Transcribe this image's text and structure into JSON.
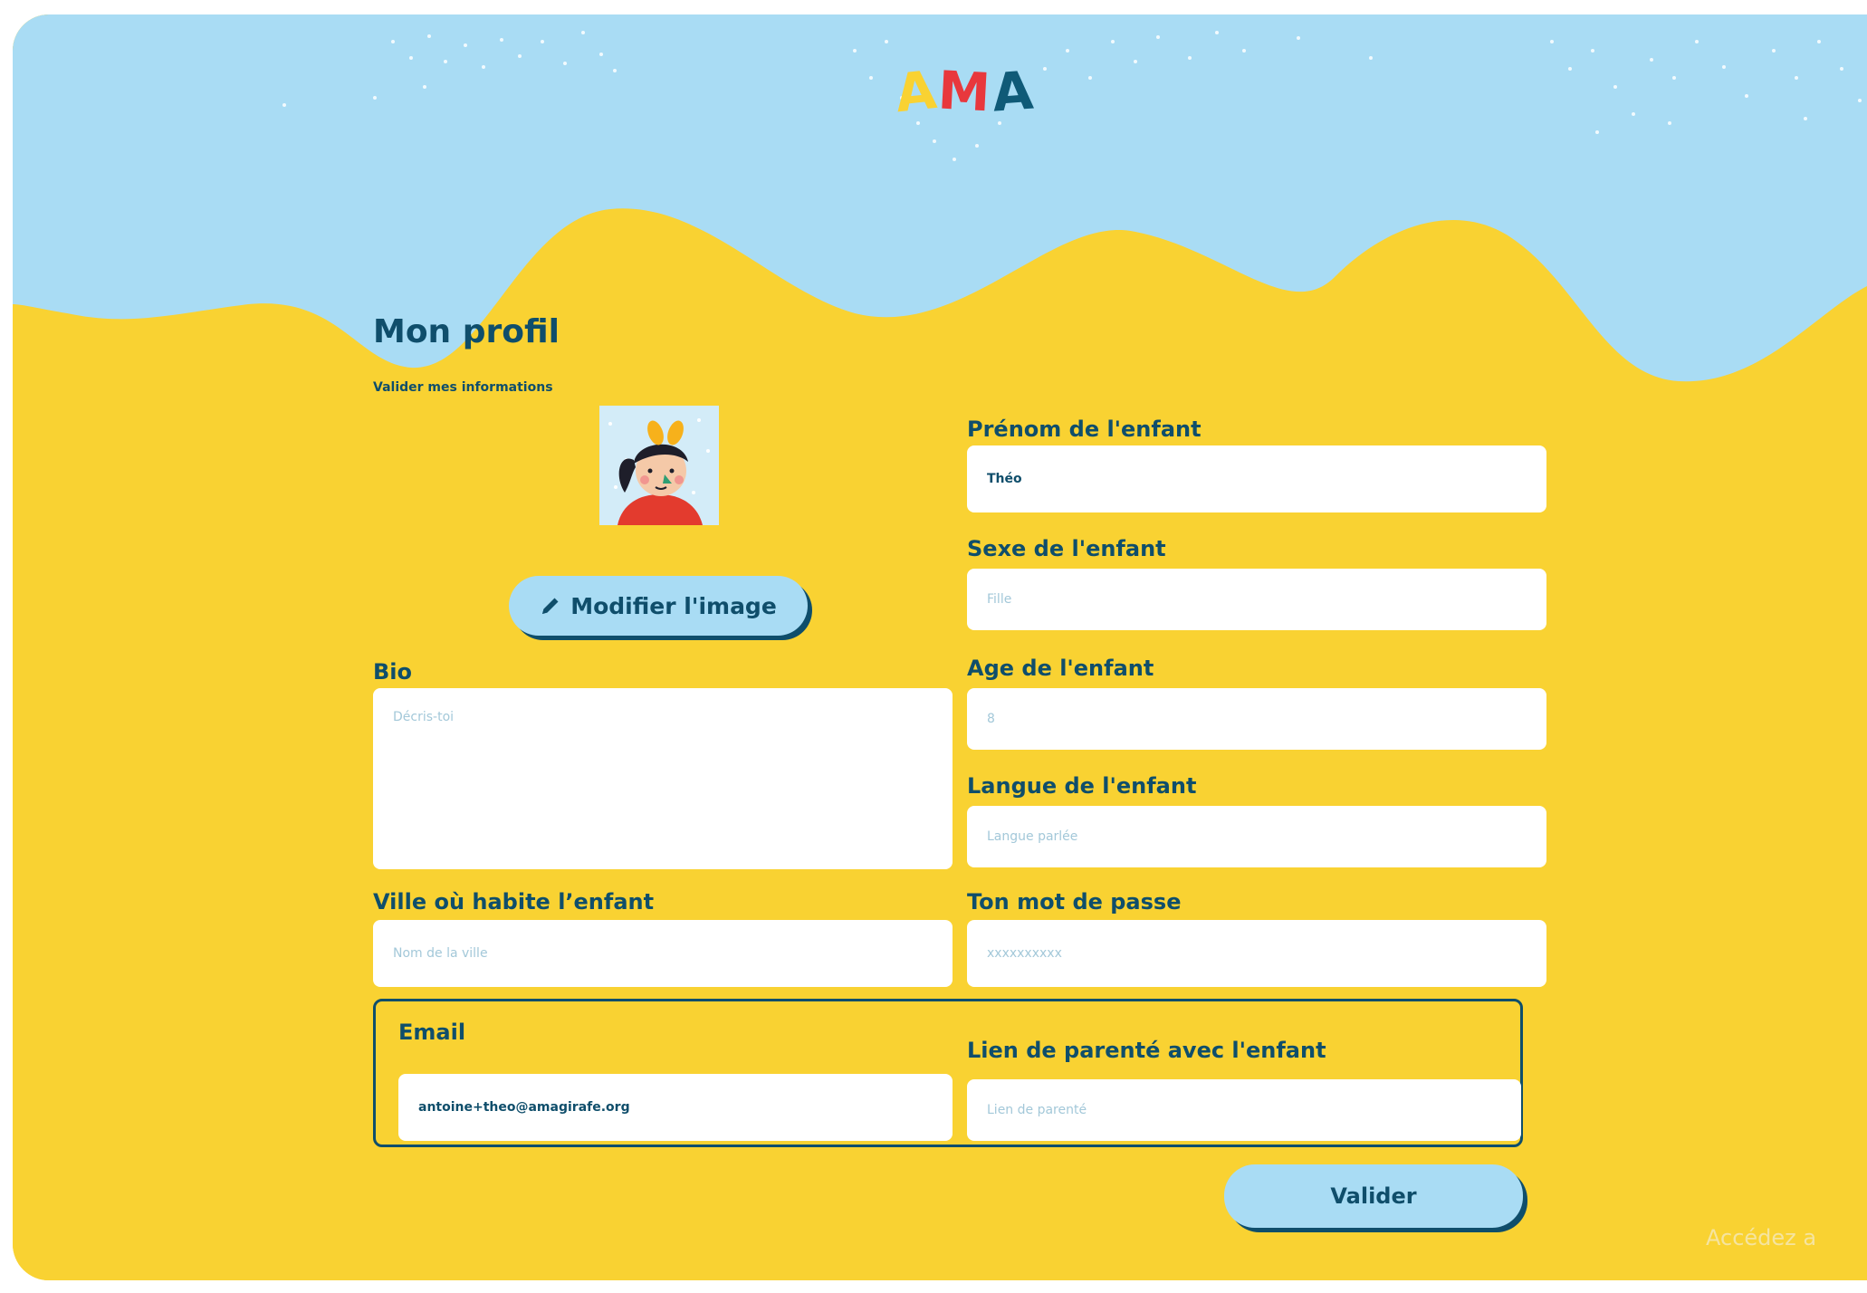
{
  "header": {
    "logo": {
      "letter_1": "A",
      "letter_2": "M",
      "letter_3": "A"
    }
  },
  "profile": {
    "title": "Mon profil",
    "subtitle": "Valider mes informations",
    "modify_image_label": "Modifier l'image",
    "modify_image_icon": "pencil-icon"
  },
  "form": {
    "bio": {
      "label": "Bio",
      "value": "",
      "placeholder": "Décris-toi"
    },
    "city": {
      "label": "Ville où habite l’enfant",
      "value": "",
      "placeholder": "Nom de la ville"
    },
    "first_name": {
      "label": "Prénom de l'enfant",
      "value": "Théo",
      "placeholder": ""
    },
    "gender": {
      "label": "Sexe de l'enfant",
      "value": "",
      "placeholder": "Fille"
    },
    "age": {
      "label": "Age de l'enfant",
      "value": "",
      "placeholder": "8"
    },
    "language": {
      "label": "Langue de l'enfant",
      "value": "",
      "placeholder": "Langue parlée"
    },
    "password": {
      "label": "Ton mot de passe",
      "value": "",
      "placeholder": "xxxxxxxxxx"
    },
    "email": {
      "label": "Email",
      "value": "antoine+theo@amagirafe.org",
      "placeholder": ""
    },
    "relationship": {
      "label": "Lien de parenté avec l'enfant",
      "value": "",
      "placeholder": "Lien de parenté"
    },
    "submit_label": "Valider"
  },
  "overlay": {
    "watermark_text": "Accédez a"
  },
  "colors": {
    "sky": "#A9DCF4",
    "sand": "#F9D232",
    "navy": "#0F4E6B",
    "field": "#FFFFFF"
  }
}
